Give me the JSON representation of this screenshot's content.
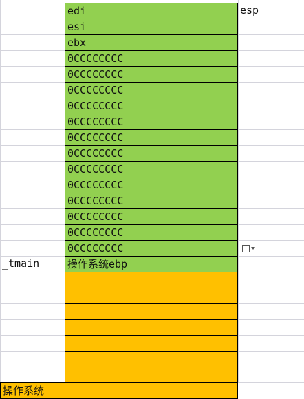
{
  "sheet": {
    "cells": {
      "esp_label": "esp",
      "tmain_label": "_tmain",
      "os_label": "操作系统",
      "green": [
        "edi",
        "esi",
        "ebx",
        "0CCCCCCCC",
        "0CCCCCCCC",
        "0CCCCCCCC",
        "0CCCCCCCC",
        "0CCCCCCCC",
        "0CCCCCCCC",
        "0CCCCCCCC",
        "0CCCCCCCC",
        "0CCCCCCCC",
        "0CCCCCCCC",
        "0CCCCCCCC",
        "0CCCCCCCC",
        "0CCCCCCCC",
        "操作系统ebp"
      ],
      "orange": [
        "",
        "",
        "",
        "",
        "",
        "",
        "",
        ""
      ]
    }
  },
  "colors": {
    "green_fill": "#92d050",
    "orange_fill": "#ffc000",
    "gridline": "#d4d4dc",
    "cell_border": "#000000"
  },
  "icons": {
    "paste_options": "paste-options-icon"
  }
}
